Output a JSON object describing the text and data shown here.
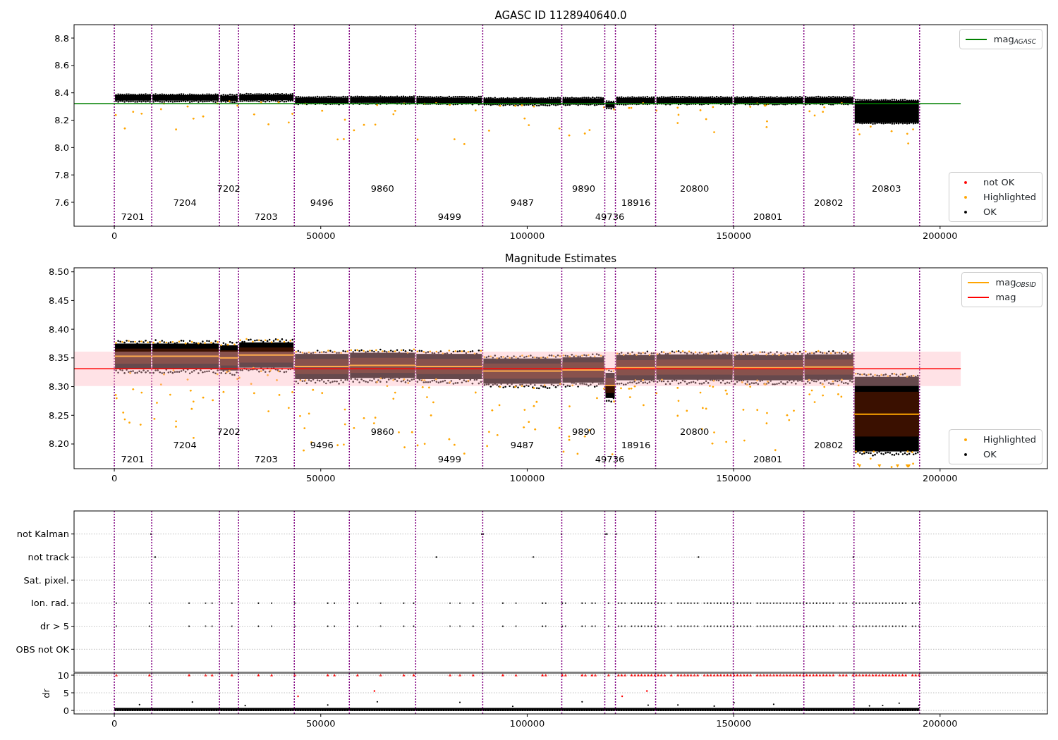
{
  "panels": [
    {
      "kind": "magnitude",
      "chart_data": {
        "type": "scatter",
        "title": "AGASC ID 1128940640.0",
        "xlim": [
          -9750,
          226000
        ],
        "ylim": [
          7.425,
          8.898
        ],
        "xticks": [
          0,
          50000,
          100000,
          150000,
          200000
        ],
        "yticks": [
          {
            "value": 7.6,
            "label": "7.6"
          },
          {
            "value": 7.8,
            "label": "7.8"
          },
          {
            "value": 8,
            "label": "8.0"
          },
          {
            "value": 8.2,
            "label": "8.2"
          },
          {
            "value": 8.4,
            "label": "8.4"
          },
          {
            "value": 8.6,
            "label": "8.6"
          },
          {
            "value": 8.8,
            "label": "8.8"
          }
        ],
        "ref_lines": [
          {
            "axis": "y",
            "value": 8.321,
            "color": "#008000"
          }
        ],
        "annotations": [
          "7201",
          "7204",
          "7202",
          "7203",
          "9496",
          "9860",
          "9499",
          "9487",
          "9890",
          "49736",
          "18916",
          "20800",
          "20801",
          "20802",
          "20803"
        ]
      },
      "legends": [
        {
          "items": [
            {
              "kind": "line",
              "label": "mag$_{AGASC}$",
              "color": "#008000"
            }
          ]
        },
        {
          "items": [
            {
              "kind": "dot",
              "label": "not OK",
              "color": "#ff0000"
            },
            {
              "kind": "dot",
              "label": "Highlighted",
              "color": "#ffa500"
            },
            {
              "kind": "dot",
              "label": "OK",
              "color": "#000000"
            }
          ]
        }
      ]
    },
    {
      "kind": "magnitude",
      "chart_data": {
        "type": "scatter",
        "title": "Magnitude Estimates",
        "xlim": [
          -9750,
          226000
        ],
        "ylim": [
          8.157,
          8.507
        ],
        "xticks": [
          0,
          50000,
          100000,
          150000,
          200000
        ],
        "yticks": [
          {
            "value": 8.2,
            "label": "8.20"
          },
          {
            "value": 8.25,
            "label": "8.25"
          },
          {
            "value": 8.3,
            "label": "8.30"
          },
          {
            "value": 8.35,
            "label": "8.35"
          },
          {
            "value": 8.4,
            "label": "8.40"
          },
          {
            "value": 8.45,
            "label": "8.45"
          },
          {
            "value": 8.5,
            "label": "8.50"
          }
        ],
        "bands": [
          {
            "axis": "y",
            "from": 8.301,
            "to": 8.361,
            "color": "#ffb6c1"
          }
        ],
        "ref_lines": [
          {
            "axis": "y",
            "value": 8.331,
            "color": "#ff0000"
          }
        ],
        "annotations": [
          "7201",
          "7204",
          "7202",
          "7203",
          "9496",
          "9860",
          "9499",
          "9487",
          "9890",
          "49736",
          "18916",
          "20800",
          "20801",
          "20802"
        ]
      },
      "legends": [
        {
          "items": [
            {
              "kind": "line",
              "label": "mag$_{OBSID}$",
              "color": "#ffa500"
            },
            {
              "kind": "line",
              "label": "mag",
              "color": "#ff0000"
            }
          ]
        },
        {
          "items": [
            {
              "kind": "dot",
              "label": "Highlighted",
              "color": "#ffa500"
            },
            {
              "kind": "dot",
              "label": "OK",
              "color": "#000000"
            }
          ]
        }
      ]
    },
    {
      "kind": "flags",
      "chart_data": {
        "type": "scatter",
        "orientation": "horizontal",
        "grid": true,
        "xlim": [
          -9750,
          226000
        ],
        "categories": [
          "not Kalman",
          "not track",
          "Sat. pixel.",
          "Ion. rad.",
          "dr > 5",
          "OBS not OK"
        ]
      }
    },
    {
      "kind": "dr",
      "chart_data": {
        "type": "scatter",
        "grid": true,
        "ylabel": "dr",
        "xlim": [
          -9750,
          226000
        ],
        "ylim": [
          -1,
          10.6
        ],
        "xticks": [
          0,
          50000,
          100000,
          150000,
          200000
        ],
        "yticks": [
          {
            "value": 0,
            "label": "0"
          },
          {
            "value": 5,
            "label": "5"
          },
          {
            "value": 10,
            "label": "10"
          }
        ]
      }
    }
  ]
}
